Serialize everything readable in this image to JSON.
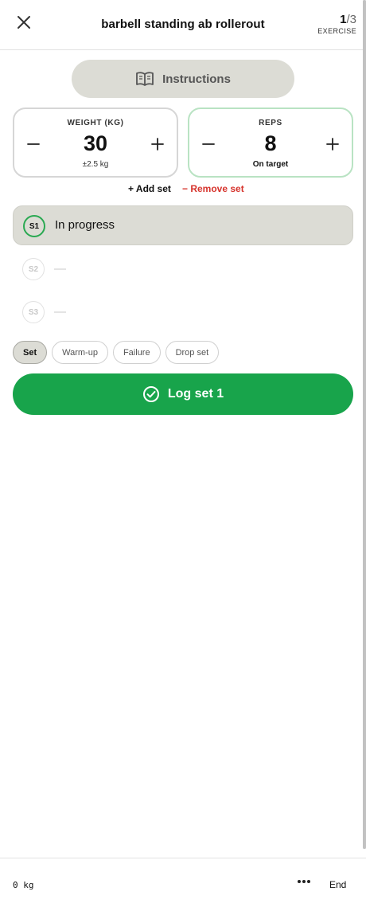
{
  "header": {
    "title": "barbell standing ab rollerout",
    "exercise_current": "1",
    "exercise_separator": "/",
    "exercise_total": "3",
    "exercise_label": "EXERCISE",
    "close_icon": "close-icon"
  },
  "instructions": {
    "label": "Instructions",
    "icon": "book-open-icon"
  },
  "weight_card": {
    "label": "WEIGHT (KG)",
    "value": "30",
    "sub": "±2.5 kg"
  },
  "reps_card": {
    "label": "REPS",
    "value": "8",
    "sub": "On target",
    "accent": "#b9e3c3"
  },
  "set_actions": {
    "add": "+ Add set",
    "remove": "− Remove set",
    "remove_color": "#d6332c"
  },
  "sets": [
    {
      "badge": "S1",
      "text": "In progress",
      "active": true
    },
    {
      "badge": "S2",
      "text": "—",
      "active": false
    },
    {
      "badge": "S3",
      "text": "—",
      "active": false
    }
  ],
  "set_types": [
    {
      "label": "Set",
      "selected": true
    },
    {
      "label": "Warm-up",
      "selected": false
    },
    {
      "label": "Failure",
      "selected": false
    },
    {
      "label": "Drop set",
      "selected": false
    }
  ],
  "log_button": {
    "label": "Log set 1",
    "icon": "check-circle-icon",
    "color": "#18a44b"
  },
  "footer": {
    "weight": "0 kg",
    "more_icon": "more-horizontal-icon",
    "end": "End"
  },
  "colors": {
    "accent_green": "#18a44b",
    "active_ring": "#2aa952",
    "panel_gray": "#dcdcd5"
  }
}
